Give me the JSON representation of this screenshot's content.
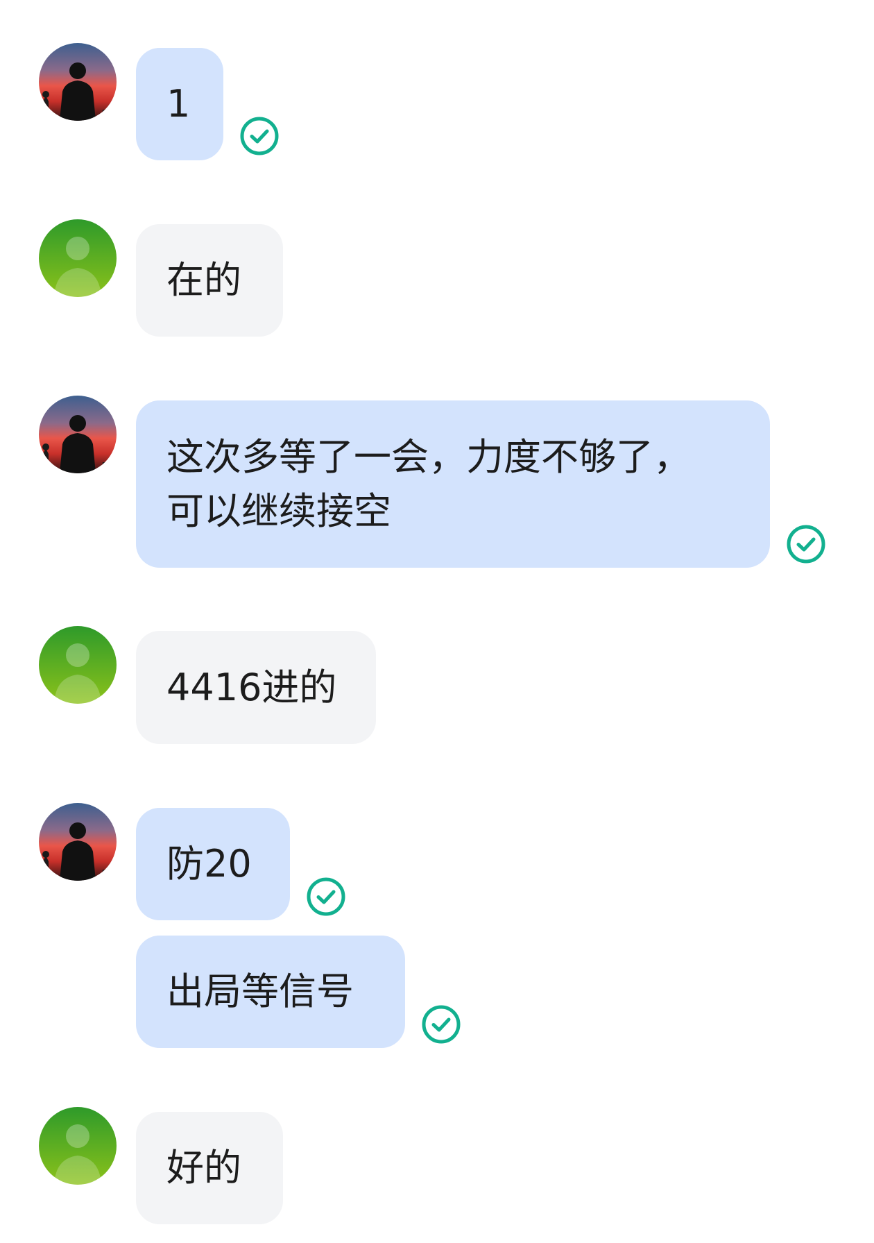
{
  "colors": {
    "sent_bubble": "#d3e3fd",
    "received_bubble": "#f3f4f6",
    "check_green": "#12b08f",
    "text": "#1c1c1c"
  },
  "messages": [
    {
      "direction": "sent",
      "avatar": "sunset-silhouette-avatar",
      "text": "1",
      "status_icon": "delivered-check-icon"
    },
    {
      "direction": "received",
      "avatar": "green-default-avatar",
      "text": "在的"
    },
    {
      "direction": "sent",
      "avatar": "sunset-silhouette-avatar",
      "text_line1": "这次多等了一会，力度不够了，",
      "text_line2": "可以继续接空",
      "status_icon": "delivered-check-icon"
    },
    {
      "direction": "received",
      "avatar": "green-default-avatar",
      "text": "4416进的"
    },
    {
      "direction": "sent",
      "avatar": "sunset-silhouette-avatar",
      "text": "防20",
      "status_icon": "delivered-check-icon"
    },
    {
      "direction": "sent",
      "text": "出局等信号",
      "status_icon": "delivered-check-icon"
    },
    {
      "direction": "received",
      "avatar": "green-default-avatar",
      "text": "好的"
    }
  ]
}
